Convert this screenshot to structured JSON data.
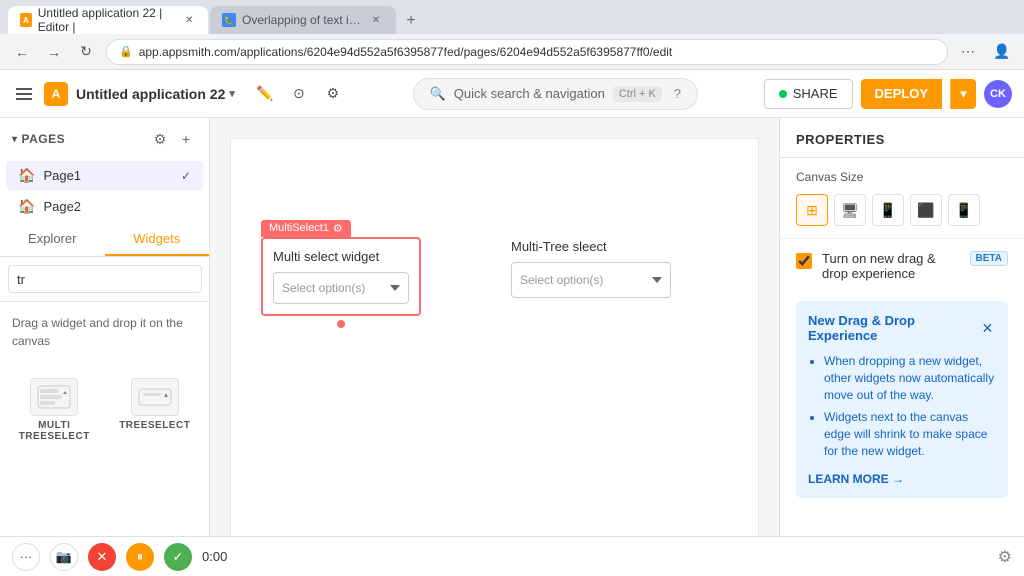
{
  "browser": {
    "tab1_title": "Untitled application 22 | Editor |",
    "tab2_title": "Overlapping of text in Tree selec...",
    "url": "app.appsmith.com/applications/6204e94d552a5f6395877fed/pages/6204e94d552a5f6395877ff0/edit"
  },
  "header": {
    "app_title": "Untitled application 22",
    "search_placeholder": "Quick search & navigation",
    "search_shortcut": "Ctrl + K",
    "share_label": "SHARE",
    "deploy_label": "DEPLOY",
    "user_initials": "CK"
  },
  "sidebar": {
    "pages_label": "PAGES",
    "page1_label": "Page1",
    "page2_label": "Page2",
    "tab_explorer": "Explorer",
    "tab_widgets": "Widgets",
    "search_value": "tr",
    "drag_hint": "Drag a widget and drop it on the canvas",
    "widget1_label": "MULTI TREESELECT",
    "widget2_label": "TREESELECT"
  },
  "canvas": {
    "widget_label": "MultiSelect1",
    "widget_title": "Multi select widget",
    "widget_placeholder": "Select option(s)",
    "tree_title": "Multi-Tree sleect",
    "tree_placeholder": "Select option(s)"
  },
  "properties": {
    "title": "PROPERTIES",
    "canvas_size_label": "Canvas Size",
    "drag_drop_label": "Turn on new drag & drop experience",
    "beta_label": "BETA",
    "info_title": "New Drag & Drop Experience",
    "info_bullet1": "When dropping a new widget, other widgets now automatically move out of the way.",
    "info_bullet2": "Widgets next to the canvas edge will shrink to make space for the new widget.",
    "learn_more": "LEARN MORE →"
  },
  "bottom_bar": {
    "timer": "0:00"
  },
  "colors": {
    "orange": "#f90",
    "selected_widget": "#ff6b6b",
    "info_bg": "#e8f4fd",
    "info_text": "#1565c0"
  }
}
